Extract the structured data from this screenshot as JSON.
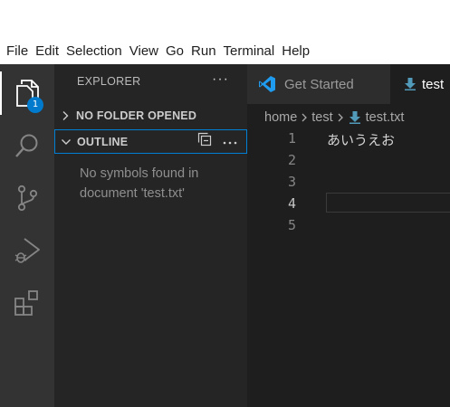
{
  "menubar": {
    "items": [
      "File",
      "Edit",
      "Selection",
      "View",
      "Go",
      "Run",
      "Terminal",
      "Help"
    ]
  },
  "activitybar": {
    "icons": [
      "files-icon",
      "search-icon",
      "source-control-icon",
      "run-debug-icon",
      "extensions-icon"
    ],
    "explorer_badge": "1"
  },
  "sidebar": {
    "title": "EXPLORER",
    "more": "···",
    "sections": {
      "no_folder": {
        "label": "NO FOLDER OPENED"
      },
      "outline": {
        "label": "OUTLINE",
        "empty_message": "No symbols found in document 'test.txt'"
      }
    }
  },
  "editor": {
    "tabs": [
      {
        "label": "Get Started",
        "icon": "vscode-logo-icon"
      },
      {
        "label": "test",
        "icon": "download-arrow-file-icon"
      }
    ],
    "breadcrumb": {
      "items": [
        "home",
        "test",
        "test.txt"
      ]
    },
    "line_numbers": [
      "1",
      "2",
      "3",
      "4",
      "5"
    ],
    "lines": [
      "あいうえお",
      "",
      "",
      "",
      ""
    ],
    "current_line": "4"
  },
  "colors": {
    "activitybar": "#333333",
    "sidebar": "#252526",
    "editor": "#1e1e1e",
    "accent": "#007acc",
    "file_icon": "#519aba"
  }
}
